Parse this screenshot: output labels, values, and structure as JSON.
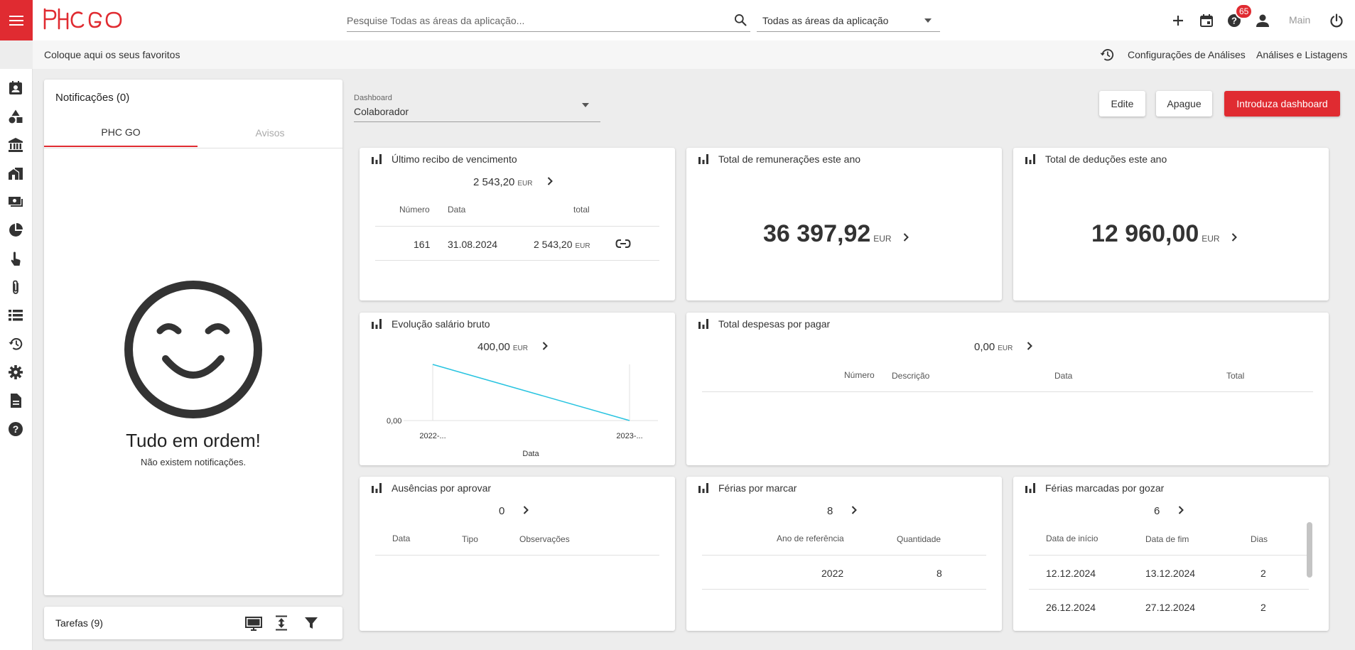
{
  "header": {
    "logo_text": "PHC GO",
    "search_placeholder": "Pesquise Todas as áreas da aplicação...",
    "area_select": "Todas as áreas da aplicação",
    "badge_count": "65",
    "main_label": "Main"
  },
  "favbar": {
    "text": "Coloque aqui os seus favoritos",
    "config": "Configurações de Análises",
    "lists": "Análises e Listagens"
  },
  "notifications": {
    "title": "Notificações (0)",
    "tab1": "PHC GO",
    "tab2": "Avisos",
    "empty_title": "Tudo em ordem!",
    "empty_subtitle": "Não existem notificações."
  },
  "tasks": {
    "title": "Tarefas (9)"
  },
  "dashboard": {
    "label": "Dashboard",
    "value": "Colaborador",
    "edit": "Edite",
    "delete": "Apague",
    "add": "Introduza dashboard"
  },
  "receipt": {
    "title": "Último recibo de vencimento",
    "value": "2 543,20",
    "currency": "EUR",
    "col_numero": "Número",
    "col_data": "Data",
    "col_total": "total",
    "row_numero": "161",
    "row_data": "31.08.2024",
    "row_total": "2 543,20",
    "row_currency": "EUR"
  },
  "remuneracoes": {
    "title": "Total de remunerações este ano",
    "value": "36 397,92",
    "currency": "EUR"
  },
  "deducoes": {
    "title": "Total de deduções este ano",
    "value": "12 960,00",
    "currency": "EUR"
  },
  "evolucao": {
    "title": "Evolução salário bruto",
    "value": "400,00",
    "currency": "EUR"
  },
  "chart_data": {
    "type": "line",
    "x": [
      "2022-...",
      "2023-..."
    ],
    "series": [
      {
        "values": [
          400,
          0
        ]
      }
    ],
    "xlabel": "Data",
    "ylabel": "",
    "ytick": "0,00",
    "ylim": [
      0,
      400
    ],
    "line_color": "#29c4e0"
  },
  "despesas": {
    "title": "Total despesas por pagar",
    "value": "0,00",
    "currency": "EUR",
    "col_numero": "Número",
    "col_descricao": "Descrição",
    "col_data": "Data",
    "col_total": "Total"
  },
  "ausencias": {
    "title": "Ausências por aprovar",
    "value": "0",
    "col_data": "Data",
    "col_tipo": "Tipo",
    "col_obs": "Observações"
  },
  "ferias_marcar": {
    "title": "Férias por marcar",
    "value": "8",
    "col_ano": "Ano de referência",
    "col_qtd": "Quantidade",
    "row_ano": "2022",
    "row_qtd": "8"
  },
  "ferias_gozar": {
    "title": "Férias marcadas por gozar",
    "value": "6",
    "col_inicio": "Data de início",
    "col_fim": "Data de fim",
    "col_dias": "Dias",
    "rows": [
      {
        "inicio": "12.12.2024",
        "fim": "13.12.2024",
        "dias": "2"
      },
      {
        "inicio": "26.12.2024",
        "fim": "27.12.2024",
        "dias": "2"
      }
    ]
  },
  "colors": {
    "accent": "#e02b31",
    "line": "#29c4e0"
  }
}
